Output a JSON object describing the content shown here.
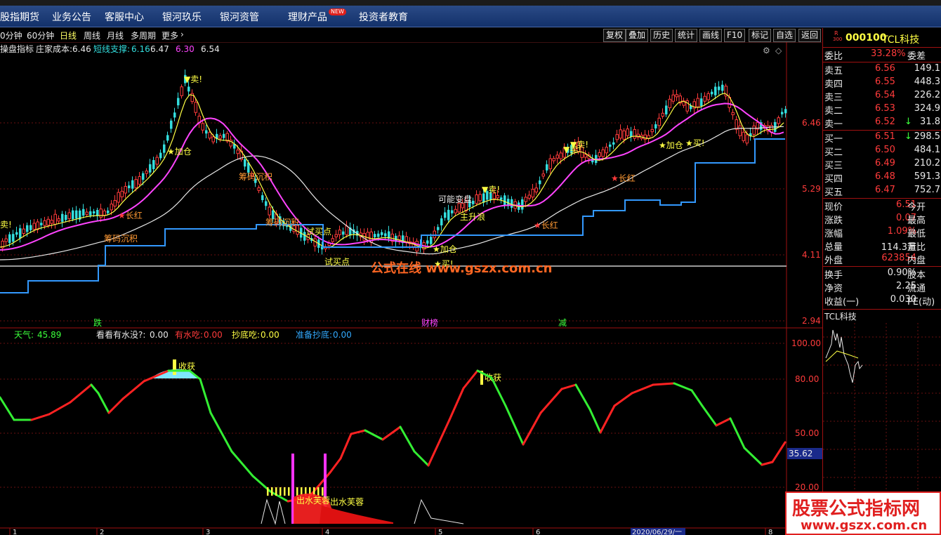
{
  "menu": {
    "items": [
      "股指期货",
      "业务公告",
      "客服中心",
      "银河玖乐",
      "银河资管",
      "理财产品",
      "投资者教育"
    ],
    "new_badge": "NEW"
  },
  "periods": [
    "0分钟",
    "60分钟",
    "日线",
    "周线",
    "月线",
    "多周期",
    "更多"
  ],
  "active_period": "日线",
  "tools": [
    "复权",
    "叠加",
    "历史",
    "统计",
    "画线",
    "F10",
    "标记",
    "自选",
    "返回"
  ],
  "main_header": {
    "indicator_name": "操盘指标",
    "cost_label": "庄家成本:",
    "cost_value": "6.46",
    "support_label": "短线支撑:",
    "v1": "6.16",
    "v2": "6.47",
    "v3": "6.30",
    "v4": "6.54"
  },
  "price_axis": [
    "6.46",
    "5.29",
    "4.11",
    "2.94"
  ],
  "annotations": {
    "sell": "卖!",
    "add": "加仓",
    "buy": "买!",
    "long_red": "长红",
    "chip_settle": "筹码沉积",
    "trial_buy": "试买点",
    "maybe_change": "可能变盘",
    "rise_wave": "主升浪",
    "fall": "跌",
    "list": "财榜",
    "reduce": "减",
    "watermark_site": "公式在线 www.gszx.com.cn"
  },
  "ind_header": {
    "weather_label": "天气:",
    "weather_value": "45.89",
    "water_label": "看看有水没?:",
    "water_value": "0.00",
    "eat_label": "有水吃:",
    "eat_value": "0.00",
    "bottom_label": "抄底吃:",
    "bottom_value": "0.00",
    "prep_label": "准备抄底:",
    "prep_value": "0.00"
  },
  "ind_axis": [
    "100.00",
    "80.00",
    "50.00",
    "20.00"
  ],
  "ind_current": "35.62",
  "ind_annotations": {
    "harvest": "收获",
    "lotus": "出水芙蓉"
  },
  "date_label": "2020/06/29/一",
  "quote": {
    "code": "000100",
    "name": "TCL科技",
    "r_label": "R",
    "r_sub": "300",
    "ratio_label": "委比",
    "ratio_value": "33.28%",
    "diff_label": "委差",
    "asks": [
      {
        "label": "卖五",
        "price": "6.56",
        "vol": "149.1"
      },
      {
        "label": "卖四",
        "price": "6.55",
        "vol": "448.3"
      },
      {
        "label": "卖三",
        "price": "6.54",
        "vol": "226.2"
      },
      {
        "label": "卖二",
        "price": "6.53",
        "vol": "324.9"
      },
      {
        "label": "卖一",
        "price": "6.52",
        "vol": "31.8"
      }
    ],
    "bids": [
      {
        "label": "买一",
        "price": "6.51",
        "vol": "298.5"
      },
      {
        "label": "买二",
        "price": "6.50",
        "vol": "484.1"
      },
      {
        "label": "买三",
        "price": "6.49",
        "vol": "210.2"
      },
      {
        "label": "买四",
        "price": "6.48",
        "vol": "591.3"
      },
      {
        "label": "买五",
        "price": "6.47",
        "vol": "752.7"
      }
    ],
    "stats": [
      {
        "label": "现价",
        "value": "6.51",
        "label2": "今开",
        "cls": "red"
      },
      {
        "label": "涨跌",
        "value": "0.07",
        "label2": "最高",
        "cls": "red"
      },
      {
        "label": "涨幅",
        "value": "1.09%",
        "label2": "最低",
        "cls": "red"
      },
      {
        "label": "总量",
        "value": "114.3万",
        "label2": "量比",
        "cls": "white"
      },
      {
        "label": "外盘",
        "value": "623854",
        "label2": "内盘",
        "cls": "red"
      }
    ],
    "stats2": [
      {
        "label": "换手",
        "value": "0.90%",
        "label2": "股本"
      },
      {
        "label": "净资",
        "value": "2.25",
        "label2": "流通"
      },
      {
        "label": "收益(一)",
        "value": "0.030",
        "label2": "PE(动)"
      }
    ],
    "mini_title": "TCL科技"
  },
  "watermark": {
    "title": "股票公式指标网",
    "url": "www.gszx.com.cn"
  }
}
